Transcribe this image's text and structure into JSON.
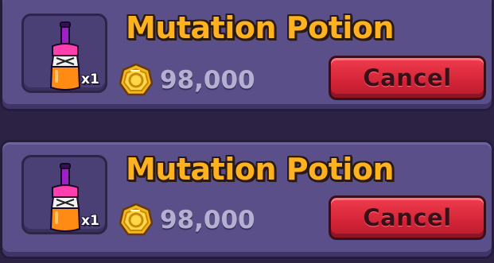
{
  "listings": [
    {
      "item_name": "Mutation Potion",
      "quantity": "x1",
      "price": "98,000",
      "cancel_label": "Cancel"
    },
    {
      "item_name": "Mutation Potion",
      "quantity": "x1",
      "price": "98,000",
      "cancel_label": "Cancel"
    }
  ],
  "icons": {
    "item": "mutation-potion-icon",
    "currency": "gold-coin-icon"
  },
  "colors": {
    "panel": "#5a4f88",
    "title": "#ffb21e",
    "cancel_button": "#d42437",
    "price": "#b5b0cf"
  }
}
